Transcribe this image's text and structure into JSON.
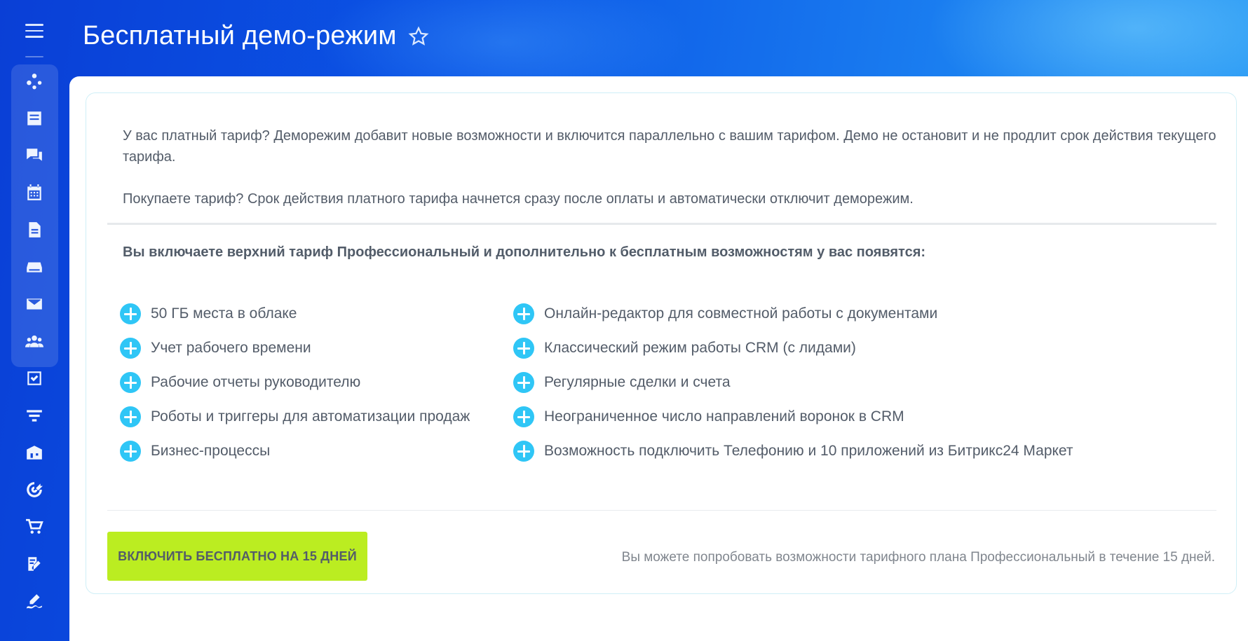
{
  "header": {
    "title": "Бесплатный демо-режим"
  },
  "sidebar": {
    "icons": [
      "menu-icon",
      "feed-icon",
      "tasks-icon",
      "chat-icon",
      "calendar-icon",
      "document-icon",
      "drive-icon",
      "mail-icon",
      "groups-icon",
      "checklist-icon",
      "funnel-icon",
      "store-icon",
      "target-icon",
      "cart-icon",
      "sign-icon",
      "signature-icon"
    ]
  },
  "intro": {
    "paragraph1": "У вас платный тариф? Деморежим добавит новые возможности и включится параллельно с вашим тарифом. Демо не остановит и не продлит срок действия текущего тарифа.",
    "paragraph2": "Покупаете тариф? Срок действия платного тарифа начнется сразу после оплаты и автоматически отключит деморежим."
  },
  "subtitle": "Вы включаете верхний тариф Профессиональный и дополнительно к бесплатным возможностям у вас появятся:",
  "features": {
    "left": [
      "50 ГБ места в облаке",
      "Учет рабочего времени",
      "Рабочие отчеты руководителю",
      "Роботы и триггеры для автоматизации продаж",
      "Бизнес-процессы"
    ],
    "right": [
      "Онлайн-редактор для совместной работы с документами",
      "Классический режим работы CRM (с лидами)",
      "Регулярные сделки и счета",
      "Неограниченное число направлений воронок в CRM",
      "Возможность подключить Телефонию и 10 приложений из Битрикс24 Маркет"
    ]
  },
  "cta": {
    "label": "ВКЛЮЧИТЬ БЕСПЛАТНО НА 15 ДНЕЙ"
  },
  "note": "Вы можете попробовать возможности тарифного плана Профессиональный в течение 15 дней.",
  "colors": {
    "accent_plus": "#2fc6f6",
    "cta_bg": "#bbed21",
    "text": "#535c69"
  }
}
